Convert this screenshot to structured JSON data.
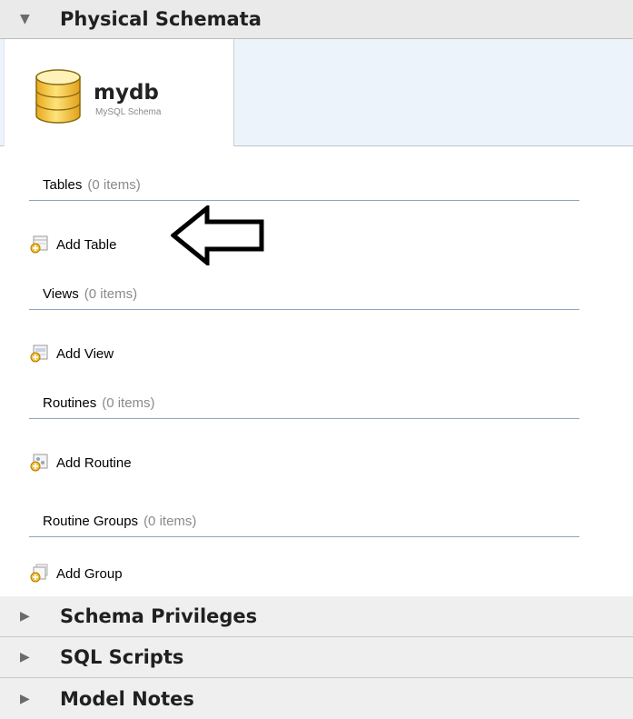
{
  "sections": {
    "physical": {
      "title": "Physical Schemata",
      "expanded": true
    },
    "privileges": {
      "title": "Schema Privileges",
      "expanded": false
    },
    "sql_scripts": {
      "title": "SQL Scripts",
      "expanded": false
    },
    "model_notes": {
      "title": "Model Notes",
      "expanded": false
    }
  },
  "schema_tab": {
    "name": "mydb",
    "subtitle": "MySQL Schema",
    "icon": "database-icon"
  },
  "groups": {
    "tables": {
      "label": "Tables",
      "count": "(0 items)",
      "add_label": "Add Table",
      "icon": "add-table-icon"
    },
    "views": {
      "label": "Views",
      "count": "(0 items)",
      "add_label": "Add View",
      "icon": "add-view-icon"
    },
    "routines": {
      "label": "Routines",
      "count": "(0 items)",
      "add_label": "Add Routine",
      "icon": "add-routine-icon"
    },
    "routine_groups": {
      "label": "Routine Groups",
      "count": "(0 items)",
      "add_label": "Add Group",
      "icon": "add-group-icon"
    }
  },
  "annotation": {
    "icon": "left-arrow-callout"
  },
  "colors": {
    "header_bg": "#efefef",
    "tabbar_bg": "#edf3fa",
    "divider": "#8fa3c4",
    "db_gold": "#f4c542"
  }
}
